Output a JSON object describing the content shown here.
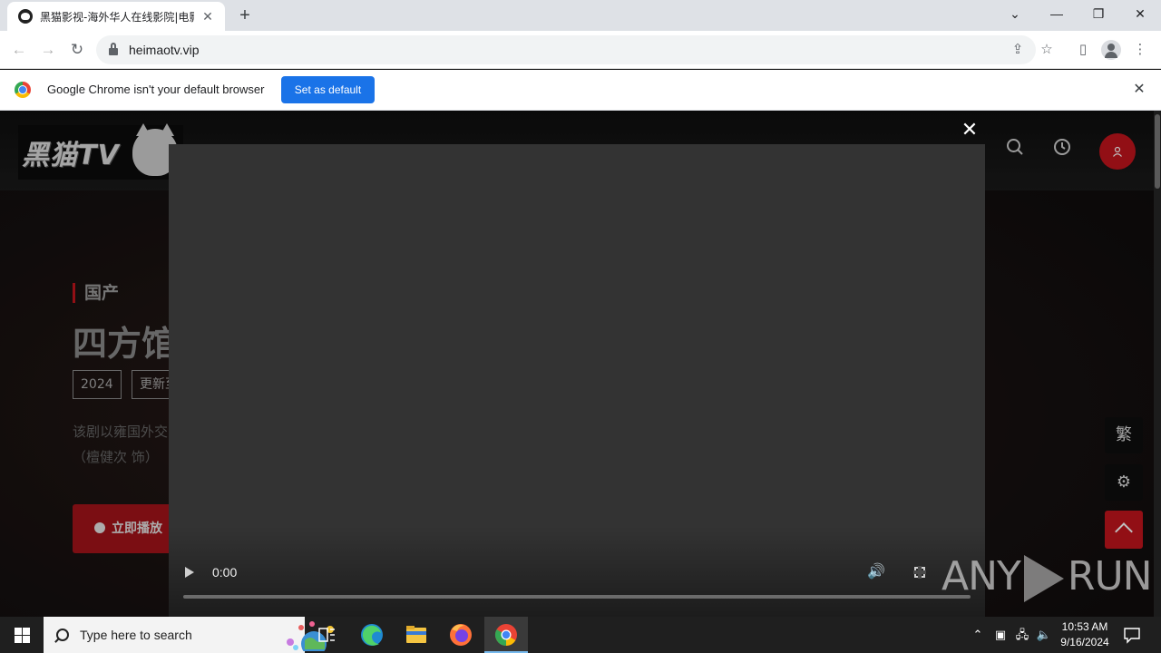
{
  "browser": {
    "tab_title": "黑猫影视-海外华人在线影院|电影",
    "tab_close": "✕",
    "new_tab": "+",
    "url": "heimaotv.vip",
    "window_controls": {
      "chevron": "⌄",
      "minimize": "—",
      "restore": "❐",
      "close": "✕"
    }
  },
  "infobar": {
    "message": "Google Chrome isn't your default browser",
    "button": "Set as default",
    "close": "✕"
  },
  "site": {
    "logo_text": "黑猫TV",
    "hero": {
      "category": "国产",
      "title": "四方馆",
      "tags": [
        "2024",
        "更新至"
      ],
      "description_line1": "该剧以雍国外交",
      "description_line2": "（檀健次 饰）",
      "play_button": "立即播放"
    },
    "side_buttons": {
      "traditional": "繁",
      "settings": "⚙"
    },
    "icons": [
      "search-icon",
      "history-icon",
      "user-icon",
      "scroll-top-icon"
    ]
  },
  "video": {
    "time": "0:00",
    "progress": 0,
    "close": "✕"
  },
  "watermark": {
    "left": "ANY",
    "right": "RUN"
  },
  "taskbar": {
    "search_placeholder": "Type here to search",
    "time": "10:53 AM",
    "date": "9/16/2024"
  },
  "colors": {
    "accent": "#c3141c",
    "chrome_blue": "#1a73e8",
    "video_bg": "#333333"
  }
}
